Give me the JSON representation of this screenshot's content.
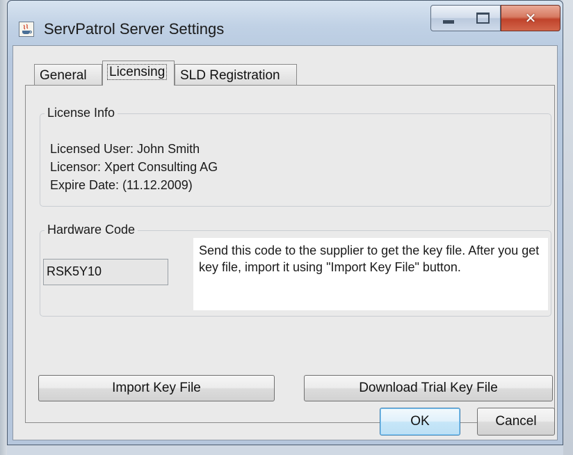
{
  "window": {
    "title": "ServPatrol Server Settings",
    "icon": "java-cup-icon",
    "controls": [
      "minimize",
      "maximize",
      "close"
    ]
  },
  "tabs": [
    {
      "label": "General",
      "selected": false
    },
    {
      "label": "Licensing",
      "selected": true
    },
    {
      "label": "SLD Registration",
      "selected": false
    }
  ],
  "license_info": {
    "title": "License Info",
    "licensed_user": "Licensed User: John Smith",
    "licensor": "Licensor: Xpert Consulting AG",
    "expire_date": "Expire Date: (11.12.2009)"
  },
  "hardware_code": {
    "title": "Hardware Code",
    "value": "RSK5Y10",
    "note": "Send this code to the supplier to get the key file. After you get key file, import it using \"Import Key File\" button."
  },
  "buttons": {
    "import": "Import Key File",
    "download_trial": "Download Trial Key File",
    "ok": "OK",
    "cancel": "Cancel"
  },
  "colors": {
    "titlebar": "#c0d1e5",
    "close_button": "#c0432b",
    "client_bg": "#eaeaea"
  }
}
